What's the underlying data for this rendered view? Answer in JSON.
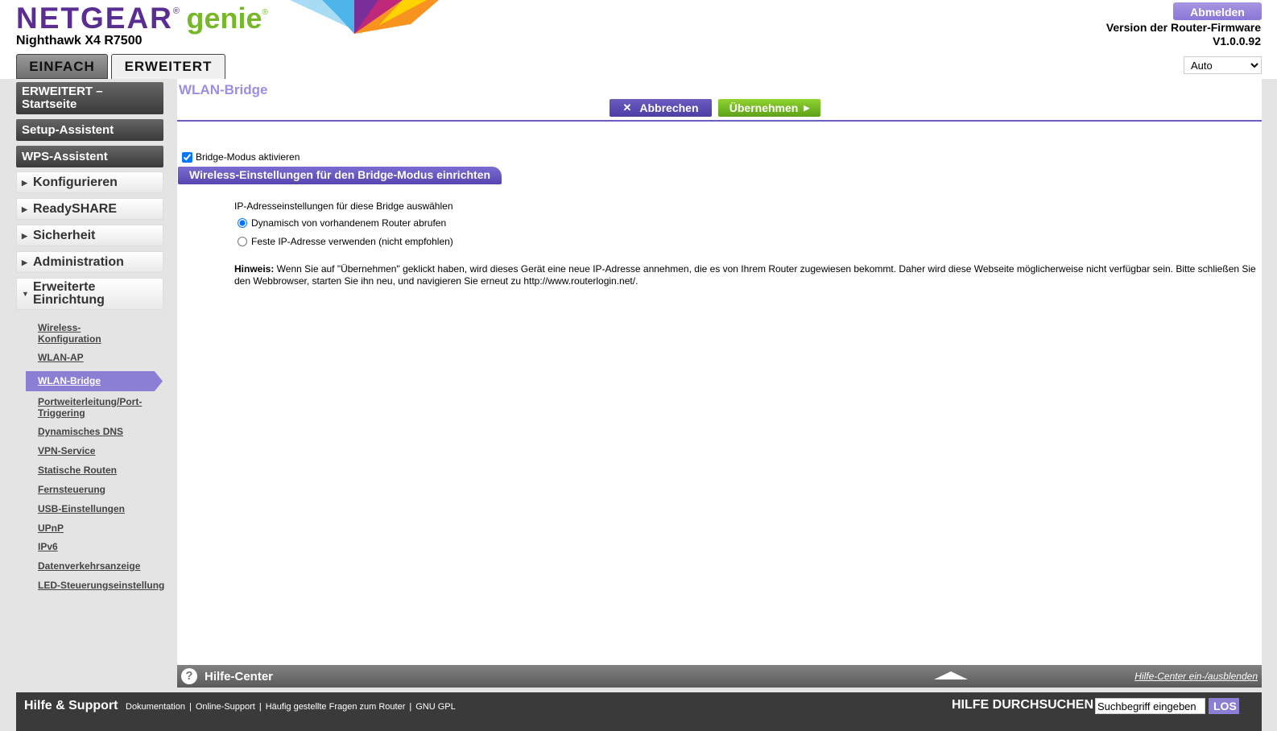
{
  "header": {
    "logo_brand": "NETGEAR",
    "logo_reg": "®",
    "logo_product": "genie",
    "model": "Nighthawk X4 R7500",
    "logout_label": "Abmelden",
    "firmware_label": "Version der Router-Firmware",
    "firmware_version": "V1.0.0.92",
    "language_selected": "Auto",
    "tabs": [
      {
        "label": "EINFACH"
      },
      {
        "label": "ERWEITERT"
      }
    ]
  },
  "sidebar": {
    "main_buttons": [
      {
        "label": "ERWEITERT – Startseite"
      },
      {
        "label": "Setup-Assistent"
      },
      {
        "label": "WPS-Assistent"
      }
    ],
    "sections": [
      {
        "label": "Konfigurieren"
      },
      {
        "label": "ReadySHARE"
      },
      {
        "label": "Sicherheit"
      },
      {
        "label": "Administration"
      },
      {
        "label": "Erweiterte Einrichtung"
      }
    ],
    "sublinks": [
      {
        "label": "Wireless-Konfiguration"
      },
      {
        "label": "WLAN-AP"
      },
      {
        "label": "WLAN-Bridge"
      },
      {
        "label": "Portweiterleitung/Port-Triggering"
      },
      {
        "label": "Dynamisches DNS"
      },
      {
        "label": "VPN-Service"
      },
      {
        "label": "Statische Routen"
      },
      {
        "label": "Fernsteuerung"
      },
      {
        "label": "USB-Einstellungen"
      },
      {
        "label": "UPnP"
      },
      {
        "label": "IPv6"
      },
      {
        "label": "Datenverkehrsanzeige"
      },
      {
        "label": "LED-Steuerungseinstellung"
      }
    ]
  },
  "main": {
    "title": "WLAN-Bridge",
    "cancel_label": "Abbrechen",
    "apply_label": "Übernehmen",
    "bridge_checkbox_label": "Bridge-Modus aktivieren",
    "bridge_checked": true,
    "section_title": "Wireless-Einstellungen für den Bridge-Modus einrichten",
    "ip_title": "IP-Adresseinstellungen für diese Bridge auswählen",
    "ip_options": [
      {
        "label": "Dynamisch von vorhandenem Router abrufen",
        "selected": true
      },
      {
        "label": "Feste IP-Adresse verwenden (nicht empfohlen)",
        "selected": false
      }
    ],
    "note_label": "Hinweis:",
    "note_text": " Wenn Sie auf \"Übernehmen\" geklickt haben, wird dieses Gerät eine neue IP-Adresse annehmen, die es von Ihrem Router zugewiesen bekommt. Daher wird diese Webseite möglicherweise nicht verfügbar sein. Bitte schließen Sie den Webbrowser, starten Sie ihn neu, und navigieren Sie erneut zu http://www.routerlogin.net/."
  },
  "helpbar": {
    "icon_glyph": "?",
    "title": "Hilfe-Center",
    "toggle_label": "Hilfe-Center ein-/ausblenden"
  },
  "footer": {
    "title": "Hilfe & Support",
    "links": [
      {
        "label": "Dokumentation"
      },
      {
        "label": "Online-Support"
      },
      {
        "label": "Häufig gestellte Fragen zum Router"
      },
      {
        "label": "GNU GPL"
      }
    ],
    "separator": "|",
    "search_label": "HILFE DURCHSUCHEN",
    "search_value": "Suchbegriff eingeben",
    "search_go": "LOS"
  },
  "colors": {
    "brand_purple": "#5a2d91",
    "brand_green": "#77b82a",
    "accent": "#8a7fd4"
  }
}
